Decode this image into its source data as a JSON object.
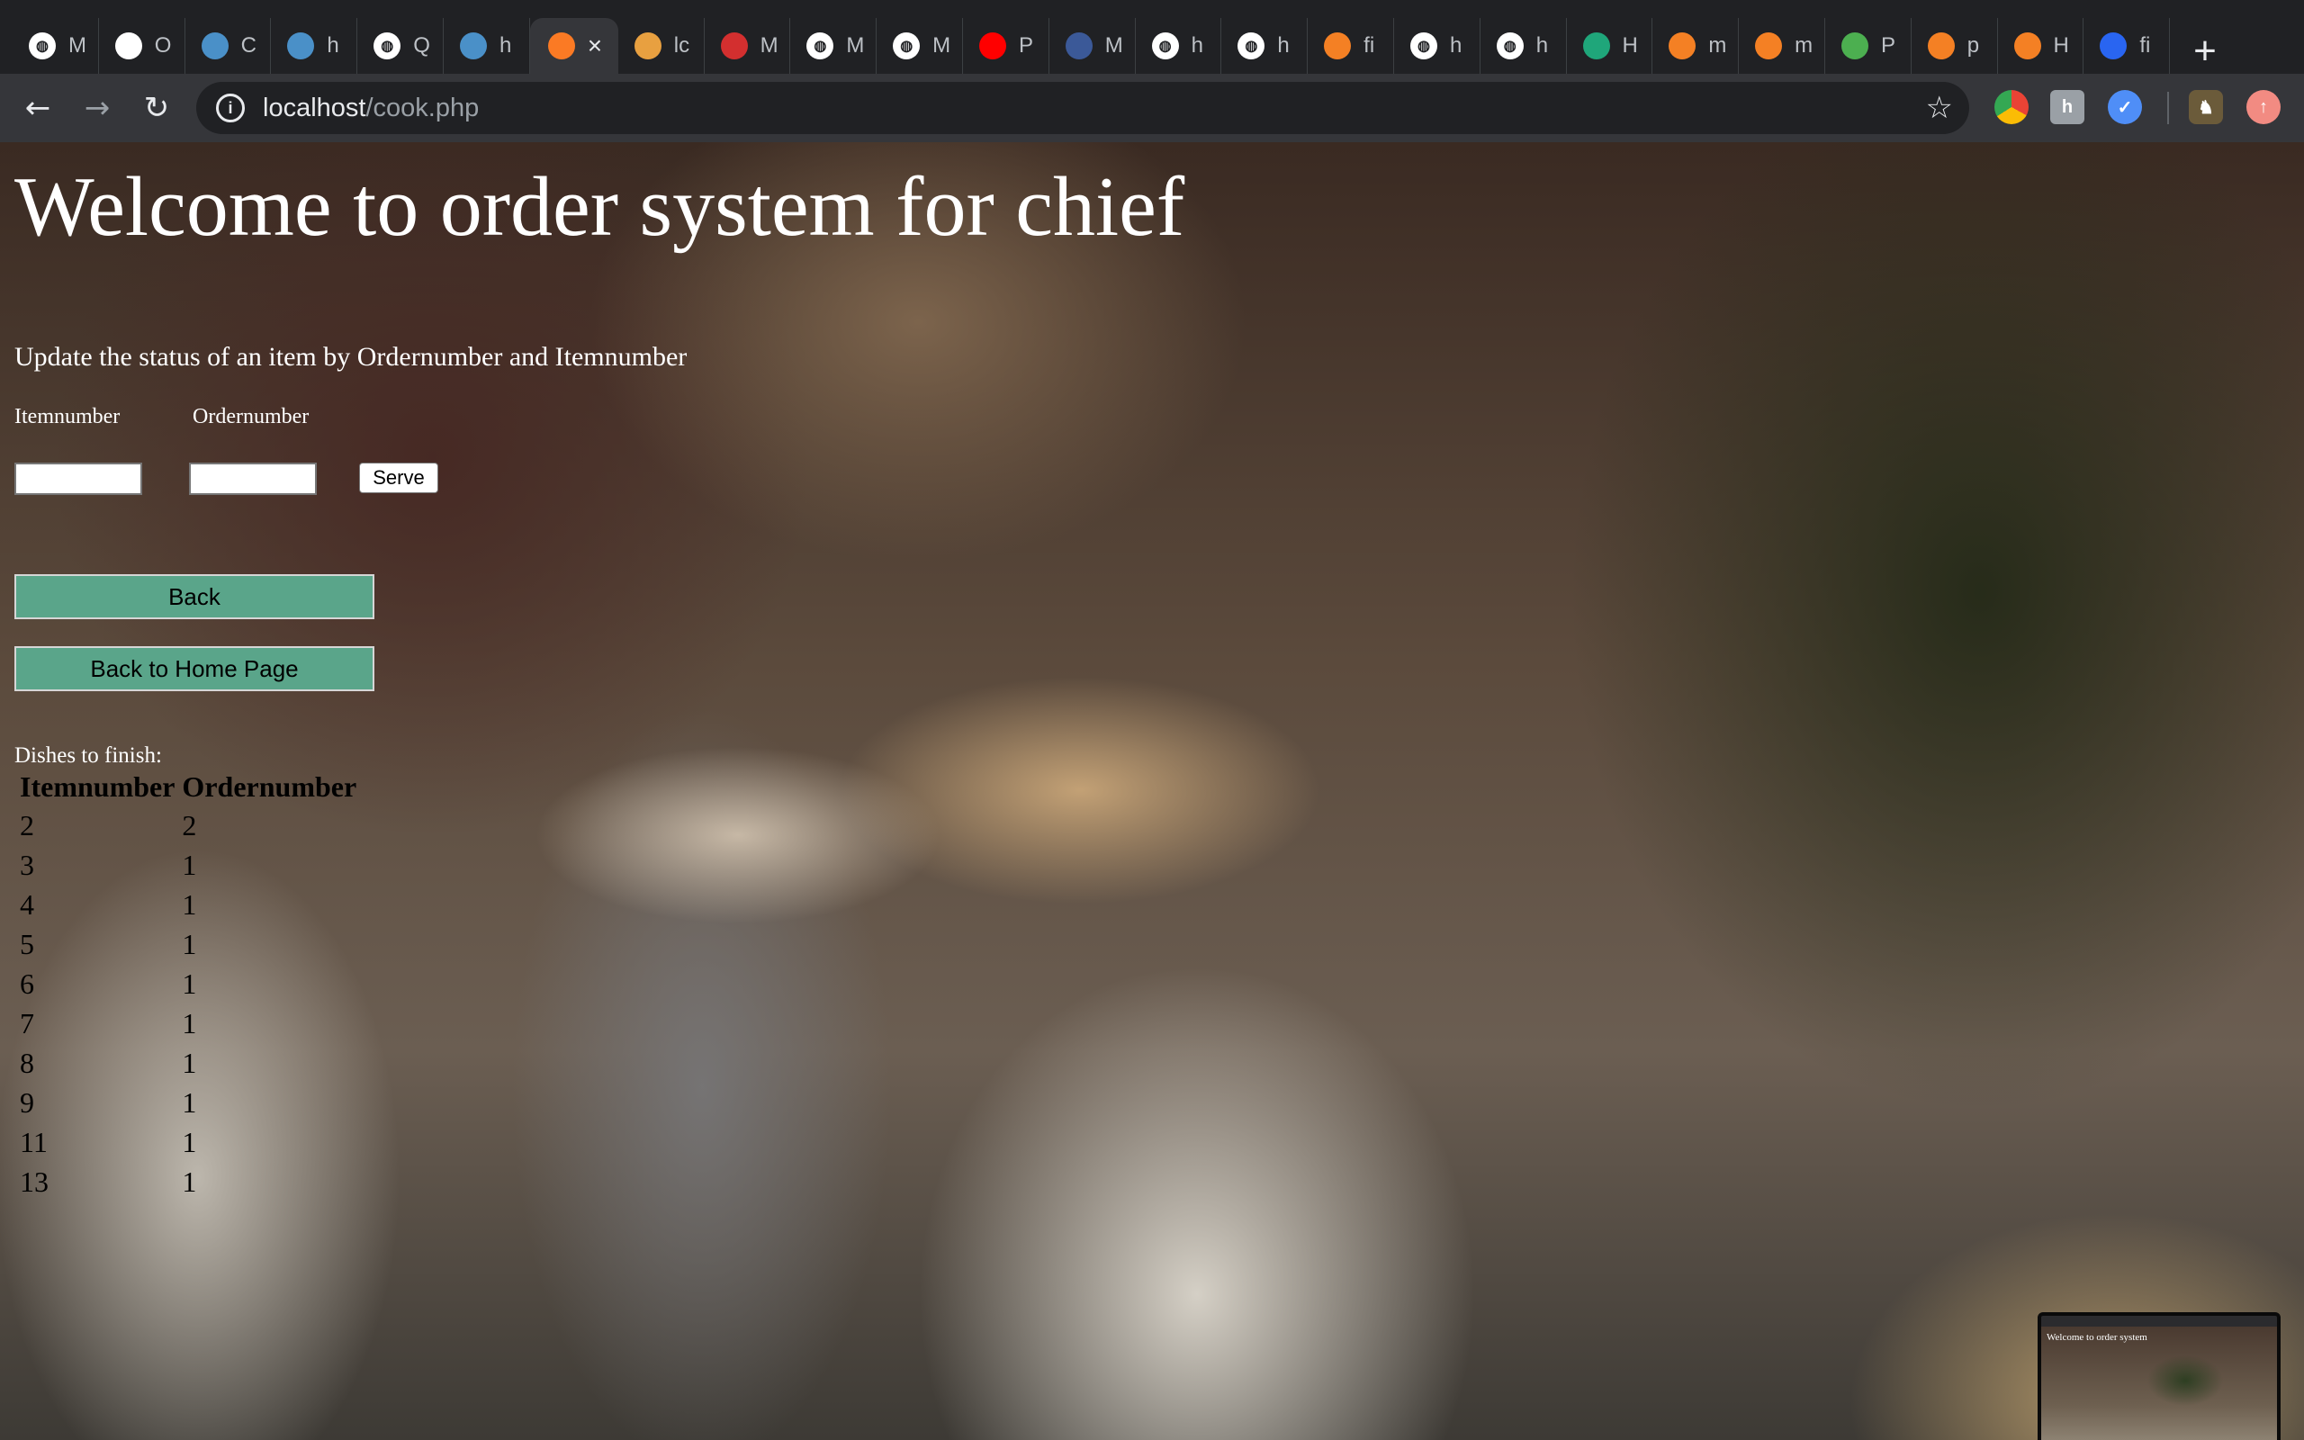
{
  "browser": {
    "tabs": [
      {
        "icon": "globe-icon",
        "label": "M",
        "color": "#ffffff"
      },
      {
        "icon": "document-icon",
        "label": "O",
        "color": "#ffffff"
      },
      {
        "icon": "p-logo-icon",
        "label": "C",
        "color": "#4a90c8"
      },
      {
        "icon": "p-logo-icon",
        "label": "h",
        "color": "#4a90c8"
      },
      {
        "icon": "globe-icon",
        "label": "Q",
        "color": "#ffffff"
      },
      {
        "icon": "p-logo-icon",
        "label": "h",
        "color": "#4a90c8"
      },
      {
        "icon": "xampp-icon",
        "label": "",
        "color": "#fb7a24",
        "active": true
      },
      {
        "icon": "mountain-icon",
        "label": "lc",
        "color": "#e8a040"
      },
      {
        "icon": "ubc-canvas-icon",
        "label": "M",
        "color": "#d32f2f"
      },
      {
        "icon": "globe-icon",
        "label": "M",
        "color": "#ffffff"
      },
      {
        "icon": "globe-icon",
        "label": "M",
        "color": "#ffffff"
      },
      {
        "icon": "youtube-icon",
        "label": "P",
        "color": "#ff0000"
      },
      {
        "icon": "facebook-icon",
        "label": "M",
        "color": "#3b5998"
      },
      {
        "icon": "globe-icon",
        "label": "h",
        "color": "#ffffff"
      },
      {
        "icon": "globe-icon",
        "label": "h",
        "color": "#ffffff"
      },
      {
        "icon": "stackoverflow-icon",
        "label": "fi",
        "color": "#f48024"
      },
      {
        "icon": "globe-icon",
        "label": "h",
        "color": "#ffffff"
      },
      {
        "icon": "globe-icon",
        "label": "h",
        "color": "#ffffff"
      },
      {
        "icon": "hexagon-icon",
        "label": "H",
        "color": "#1fa67a"
      },
      {
        "icon": "stackoverflow-icon",
        "label": "m",
        "color": "#f48024"
      },
      {
        "icon": "stackoverflow-icon",
        "label": "m",
        "color": "#f48024"
      },
      {
        "icon": "w3schools-icon",
        "label": "P",
        "color": "#4caf50"
      },
      {
        "icon": "stackoverflow-icon",
        "label": "p",
        "color": "#f48024"
      },
      {
        "icon": "stackoverflow-icon",
        "label": "H",
        "color": "#f48024"
      },
      {
        "icon": "css-icon",
        "label": "fi",
        "color": "#2965f1"
      }
    ],
    "url_host": "localhost",
    "url_path": "/cook.php"
  },
  "page": {
    "title": "Welcome to order system for chief",
    "subtitle": "Update the status of an item by Ordernumber and Itemnumber",
    "itemnumber_label": "Itemnumber",
    "ordernumber_label": "Ordernumber",
    "itemnumber_value": "",
    "ordernumber_value": "",
    "serve_label": "Serve",
    "back_label": "Back",
    "home_label": "Back to Home Page",
    "dishes_caption": "Dishes to finish:",
    "table_headers": [
      "Itemnumber",
      "Ordernumber"
    ],
    "dishes": [
      [
        "2",
        "2"
      ],
      [
        "3",
        "1"
      ],
      [
        "4",
        "1"
      ],
      [
        "5",
        "1"
      ],
      [
        "6",
        "1"
      ],
      [
        "7",
        "1"
      ],
      [
        "8",
        "1"
      ],
      [
        "9",
        "1"
      ],
      [
        "11",
        "1"
      ],
      [
        "13",
        "1"
      ]
    ],
    "thumbnail_text": "Welcome to order system"
  }
}
